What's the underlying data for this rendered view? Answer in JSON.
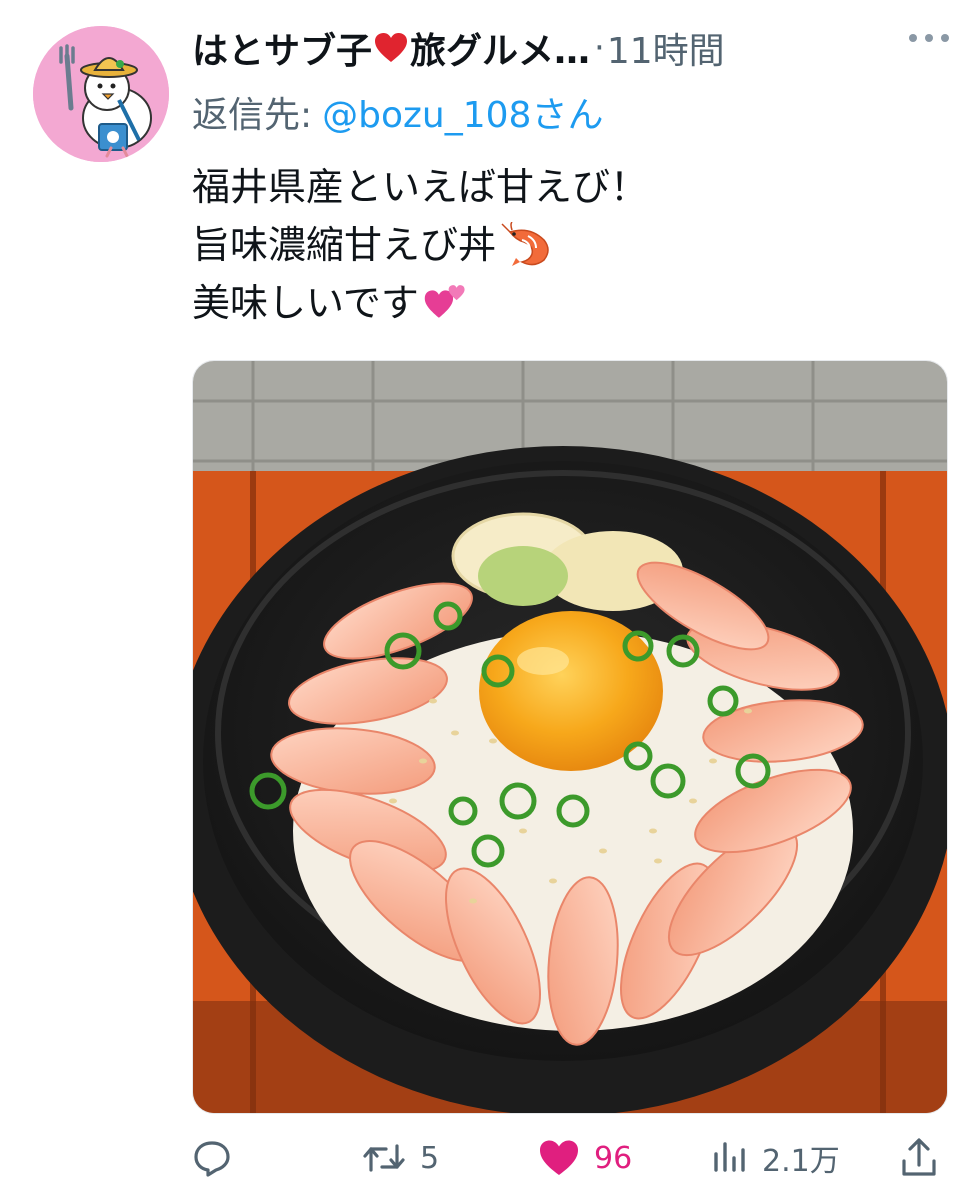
{
  "tweet": {
    "display_name": "はとサブ子",
    "display_name_suffix": "旅グルメ…",
    "separator": "·",
    "timestamp": "11時間",
    "reply_label": "返信先:",
    "reply_handle": "@bozu_108さん",
    "text_lines": [
      "福井県産といえば甘えび！",
      "旨味濃縮甘えび丼",
      "美味しいです"
    ],
    "icons": {
      "name_heart": "red-heart-emoji",
      "line2_emoji": "shrimp-emoji",
      "line3_emoji": "two-hearts-emoji"
    }
  },
  "actions": {
    "reply": {
      "icon": "reply-icon",
      "count": ""
    },
    "retweet": {
      "icon": "retweet-icon",
      "count": "5"
    },
    "like": {
      "icon": "heart-icon",
      "count": "96",
      "liked": true
    },
    "views": {
      "icon": "views-icon",
      "count": "2.1万"
    },
    "share": {
      "icon": "share-icon"
    }
  },
  "colors": {
    "text_primary": "#0f1419",
    "text_secondary": "#536471",
    "link": "#1d9bf0",
    "like_active": "#e01f7f",
    "avatar_bg": "#f3a8d2"
  }
}
